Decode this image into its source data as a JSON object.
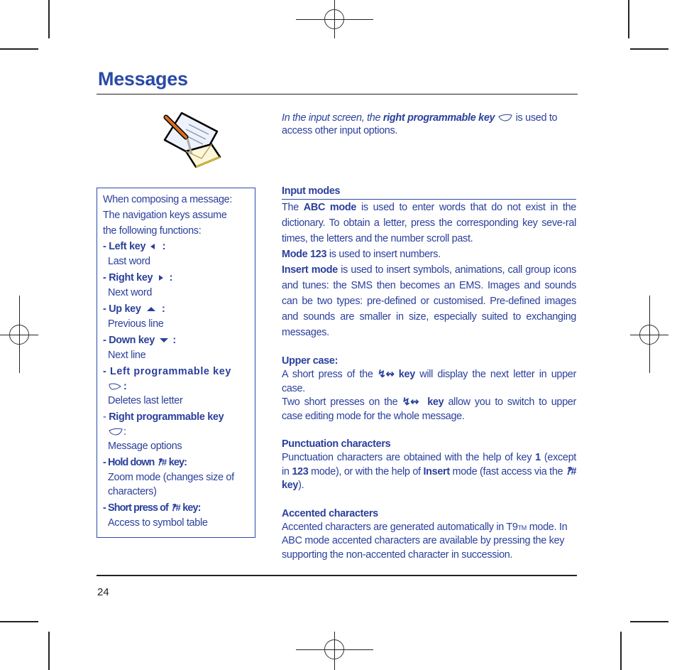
{
  "page": {
    "title": "Messages",
    "page_number": "24"
  },
  "intro": {
    "prefix": "In the input screen, the ",
    "key_label": "right programmable key",
    "suffix1": " is used to",
    "line2": "access other input options."
  },
  "nav_box": {
    "intro_line1": "When composing a message:",
    "intro_line2": "The navigation keys assume",
    "intro_line3": "the following functions:",
    "items": [
      {
        "label": "- Left key",
        "icon": "left-arrow-icon",
        "colon": " :",
        "desc": "Last word"
      },
      {
        "label": "- Right key",
        "icon": "right-arrow-icon",
        "colon": " :",
        "desc": "Next word"
      },
      {
        "label": "- Up key",
        "icon": "up-arrow-icon",
        "colon": " :",
        "desc": "Previous line"
      },
      {
        "label": "- Down key",
        "icon": "down-arrow-icon",
        "colon": " :",
        "desc": "Next line"
      },
      {
        "label": "- Left programmable key",
        "icon": "left-softkey-icon",
        "colon": ":",
        "desc": "Deletes last letter"
      },
      {
        "label_prefix": "- ",
        "label": "Right programmable key",
        "icon": "right-softkey-icon",
        "colon": ":",
        "desc": "Message options"
      },
      {
        "label": "- Hold down",
        "icon": "hash-key-icon",
        "suffix": " key:",
        "desc": "Zoom mode (changes size of characters)"
      },
      {
        "label": "- Short press of",
        "icon": "hash-key-icon",
        "suffix": " key:",
        "desc": "Access to symbol table"
      }
    ]
  },
  "sections": {
    "input_modes": {
      "heading": "Input modes",
      "p1_pre": "The ",
      "p1_bold": "ABC mode",
      "p1_post": " is used to enter words that do not exist in the dictionary. To obtain a letter, press the corresponding key seve-ral times, the letters and the number scroll past.",
      "p2_bold": "Mode 123",
      "p2_post": " is used to insert numbers.",
      "p3_bold": "Insert mode",
      "p3_post": " is used to insert symbols, animations, call group icons and tunes: the SMS then becomes an EMS. Images and sounds can be two types: pre-defined or customised. Pre-defined images and sounds are smaller in size, especially suited to exchanging messages."
    },
    "upper_case": {
      "heading": "Upper case:",
      "p1_pre": "A short press of the ",
      "key_bold": "key",
      "p1_post": " will display the next letter in upper case.",
      "p2_pre": "Two short presses on the ",
      "p2_post": " allow you to switch to upper case editing mode for the whole message."
    },
    "punctuation": {
      "heading": "Punctuation characters",
      "pre": "Punctuation characters are obtained with the help of key ",
      "key1": "1",
      "mid1": " (except in ",
      "mode123": "123",
      "mid2": " mode), or with the help of ",
      "insert": "Insert",
      "mid3": " mode (fast access via the ",
      "key_bold": "key",
      "end": ")."
    },
    "accented": {
      "heading": "Accented characters",
      "p1_pre": "Accented characters are generated automatically in T9",
      "tm": "TM",
      "p1_post": " mode. In ABC mode accented characters are available by pressing the key supporting the non-accented character in succession."
    }
  },
  "colors": {
    "text": "#2a3f9c",
    "title": "#2a4aa8",
    "rule": "#222222"
  }
}
